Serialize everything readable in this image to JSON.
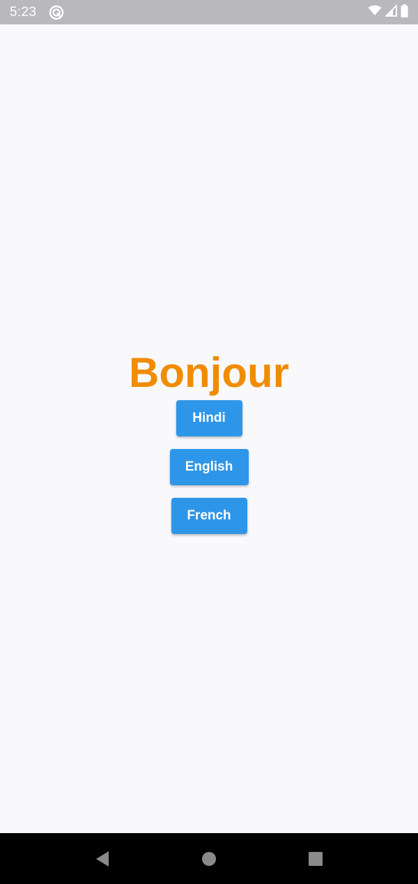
{
  "status_bar": {
    "time": "5:23",
    "icons": [
      "app-notification-icon",
      "wifi-icon",
      "signal-icon",
      "battery-icon"
    ]
  },
  "main": {
    "greeting": "Bonjour",
    "greeting_color": "#f08c00",
    "buttons": [
      {
        "label": "Hindi"
      },
      {
        "label": "English"
      },
      {
        "label": "French"
      }
    ],
    "button_color": "#2e96e8"
  },
  "nav_bar": {
    "icons": [
      "back-icon",
      "home-icon",
      "recents-icon"
    ]
  }
}
